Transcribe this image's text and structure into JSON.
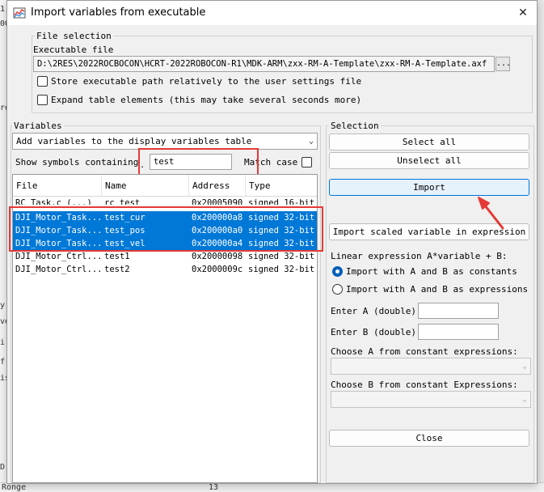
{
  "background": {
    "left_fragments": [
      "1",
      "00",
      "re",
      "y",
      "ve",
      "i",
      "f",
      "is",
      "D"
    ],
    "bottom_label": "Ronge",
    "bottom_number": "13"
  },
  "dialog": {
    "title": "Import variables from executable",
    "close_glyph": "✕"
  },
  "file_selection": {
    "group_label": "File selection",
    "exe_label": "Executable file",
    "exe_path": "D:\\2RES\\2022ROCBOCON\\HCRT-2022ROBOCON-R1\\MDK-ARM\\zxx-RM-A-Template\\zxx-RM-A-Template.axf",
    "browse_label": "...",
    "store_relative_label": "Store executable path relatively to the user settings file",
    "expand_table_label": "Expand table elements (this may take several seconds more)"
  },
  "variables": {
    "group_label": "Variables",
    "mode_value": "Add variables to the display variables table",
    "show_symbols_label": "Show symbols containing",
    "search_prefix": ". .",
    "search_value": "test",
    "match_case_label": "Match case",
    "columns": [
      "File",
      "Name",
      "Address",
      "Type"
    ],
    "rows": [
      {
        "file": "RC_Task.c (...)",
        "name": "rc_test",
        "address": "0x20005090",
        "type": "signed 16-bit",
        "selected": false,
        "cut": true
      },
      {
        "file": "DJI_Motor_Task...",
        "name": "test_cur",
        "address": "0x200000a8",
        "type": "signed 32-bit",
        "selected": true
      },
      {
        "file": "DJI_Motor_Task...",
        "name": "test_pos",
        "address": "0x200000a0",
        "type": "signed 32-bit",
        "selected": true
      },
      {
        "file": "DJI_Motor_Task...",
        "name": "test_vel",
        "address": "0x200000a4",
        "type": "signed 32-bit",
        "selected": true
      },
      {
        "file": "DJI_Motor_Ctrl...",
        "name": "test1",
        "address": "0x20000098",
        "type": "signed 32-bit",
        "selected": false
      },
      {
        "file": "DJI_Motor_Ctrl...",
        "name": "test2",
        "address": "0x2000009c",
        "type": "signed 32-bit",
        "selected": false
      }
    ]
  },
  "selection": {
    "group_label": "Selection",
    "select_all_label": "Select all",
    "unselect_all_label": "Unselect all",
    "import_label": "Import",
    "import_scaled_label": "Import scaled variable in expression",
    "linear_label": "Linear expression A*variable + B:",
    "radio_constants_label": "Import with A and B as constants",
    "radio_expressions_label": "Import with A and B as expressions",
    "enter_a_label": "Enter A (double):",
    "enter_b_label": "Enter B (double):",
    "enter_a_value": "",
    "enter_b_value": "",
    "choose_a_label": "Choose A from constant expressions:",
    "choose_b_label": "Choose B from constant Expressions:",
    "close_label": "Close"
  },
  "colors": {
    "selection_blue": "#0078d7",
    "highlight_red": "#e53935"
  }
}
